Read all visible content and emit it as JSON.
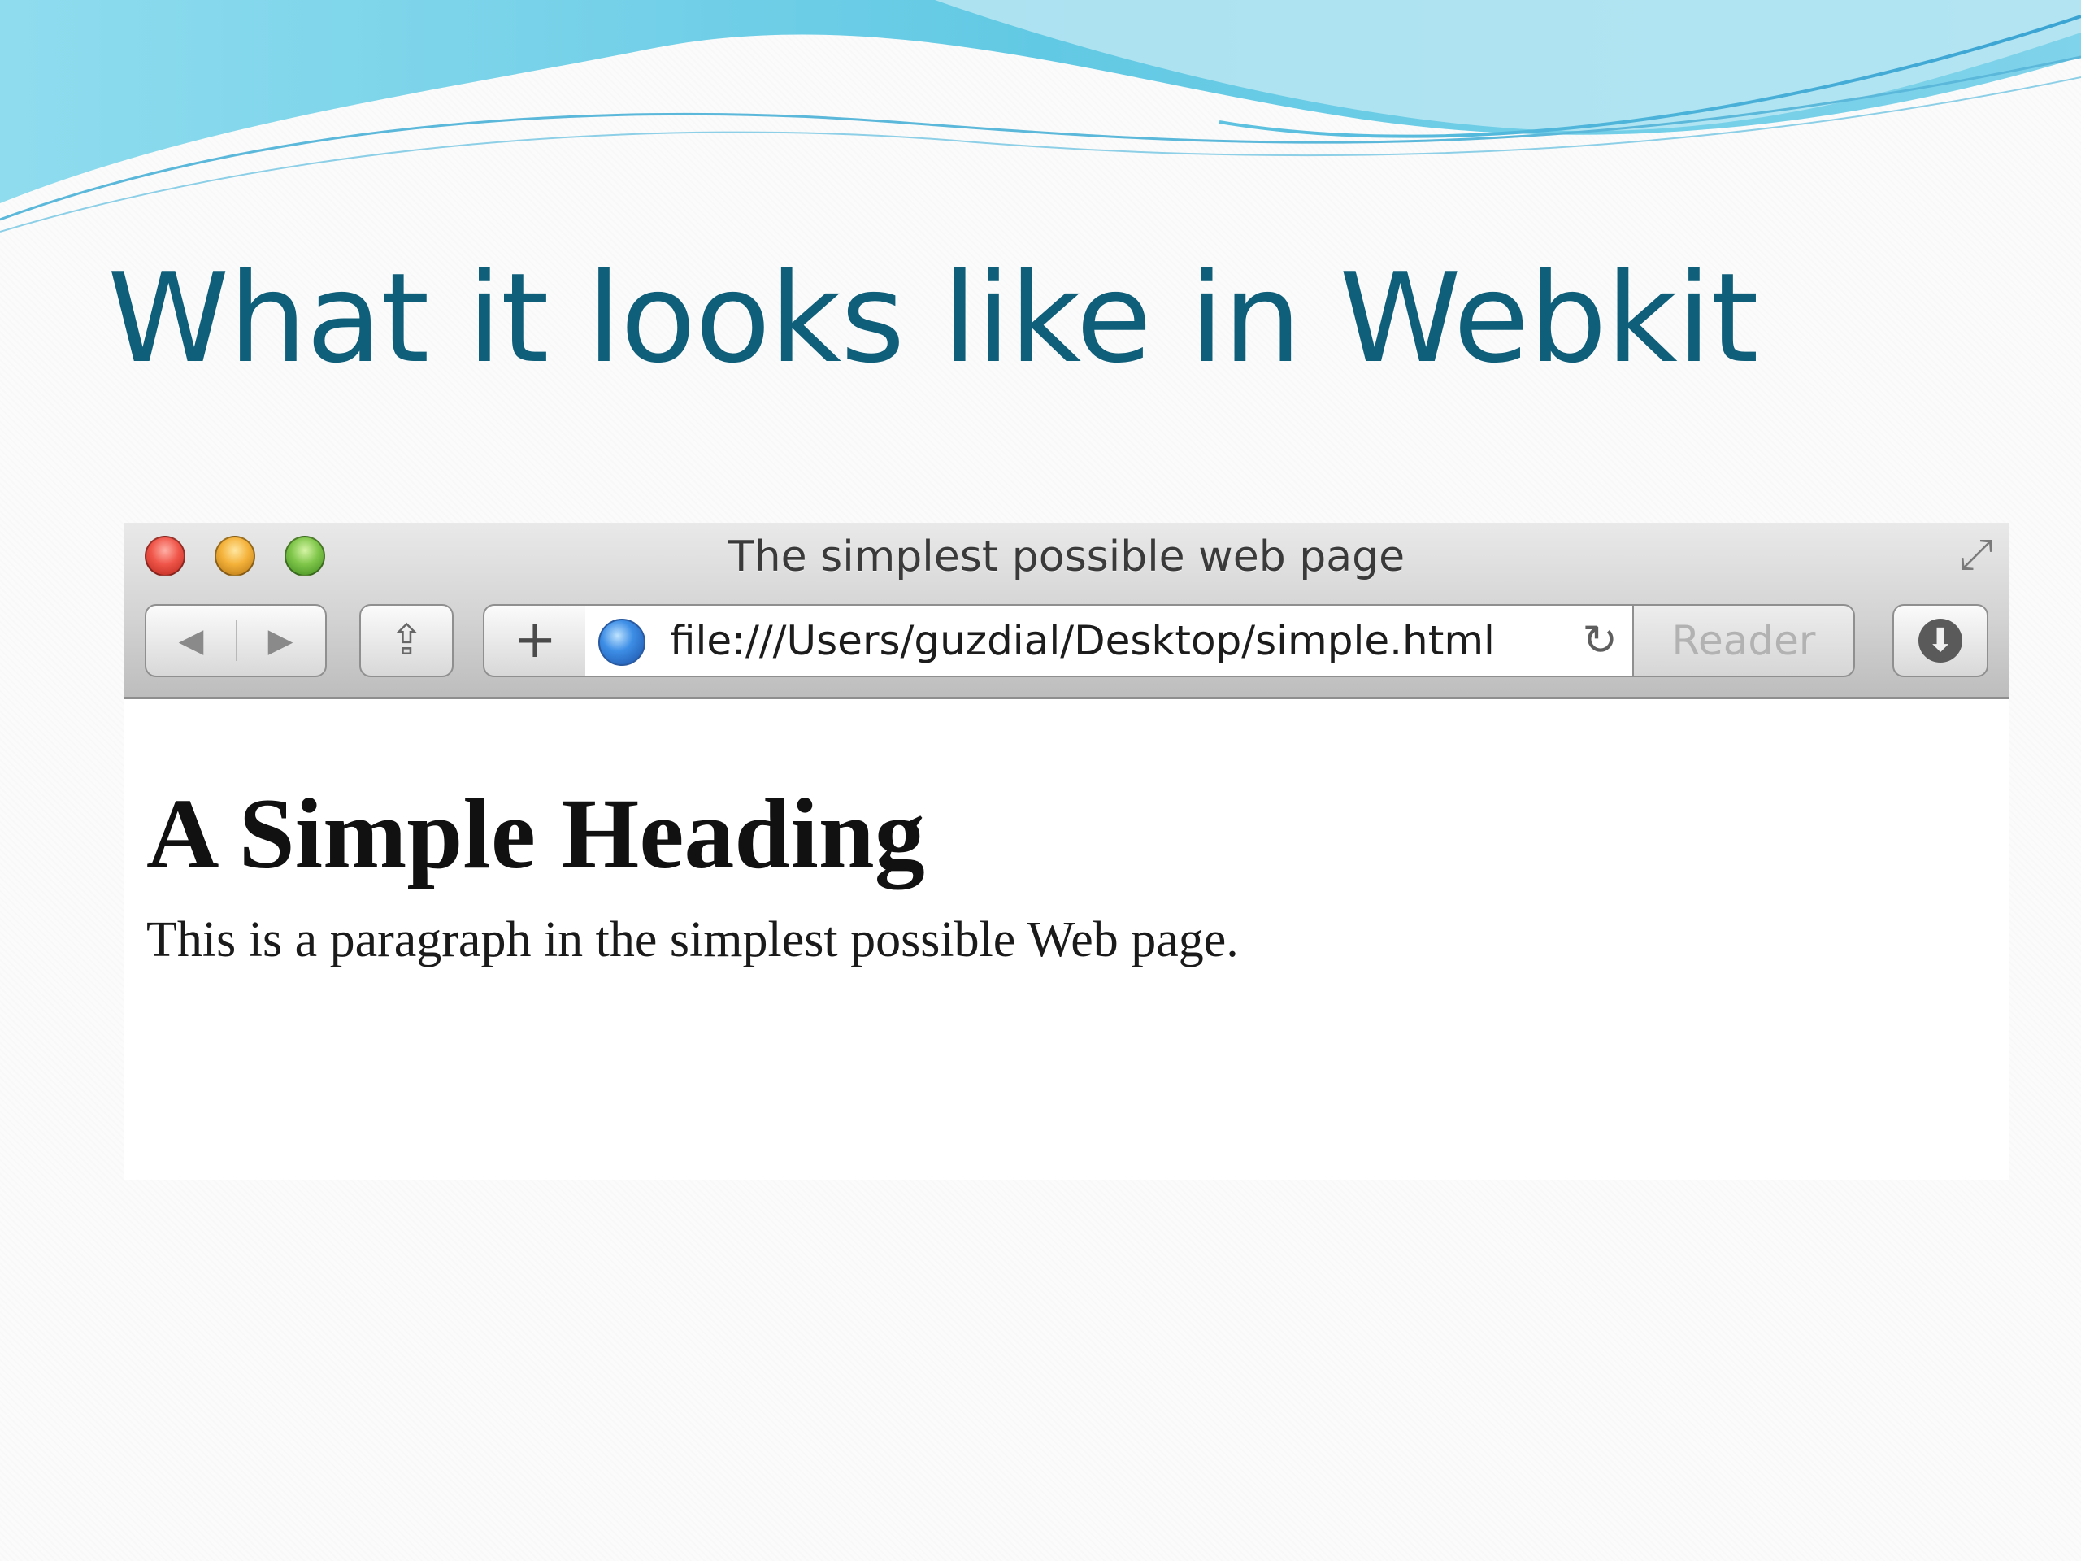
{
  "slide": {
    "title": "What it looks like in Webkit",
    "title_color": "#0f5f7a",
    "accent_wave_colors": [
      "#7fd6ea",
      "#5cc6e3",
      "#3fa8d6"
    ]
  },
  "browser": {
    "window_title": "The simplest possible web page",
    "traffic_lights": [
      {
        "name": "close",
        "color": "#f0564a"
      },
      {
        "name": "minimize",
        "color": "#f4b23a"
      },
      {
        "name": "zoom",
        "color": "#7fc64a"
      }
    ],
    "toolbar": {
      "back_icon": "◀",
      "forward_icon": "▶",
      "share_icon": "⇪",
      "add_icon": "+",
      "address": "file:///Users/guzdial/Desktop/simple.html",
      "reload_icon": "↻",
      "reader_label": "Reader",
      "download_icon": "⬇",
      "fullscreen_icon": "⤢"
    },
    "page": {
      "heading": "A Simple Heading",
      "paragraph": "This is a paragraph in the simplest possible Web page."
    }
  }
}
